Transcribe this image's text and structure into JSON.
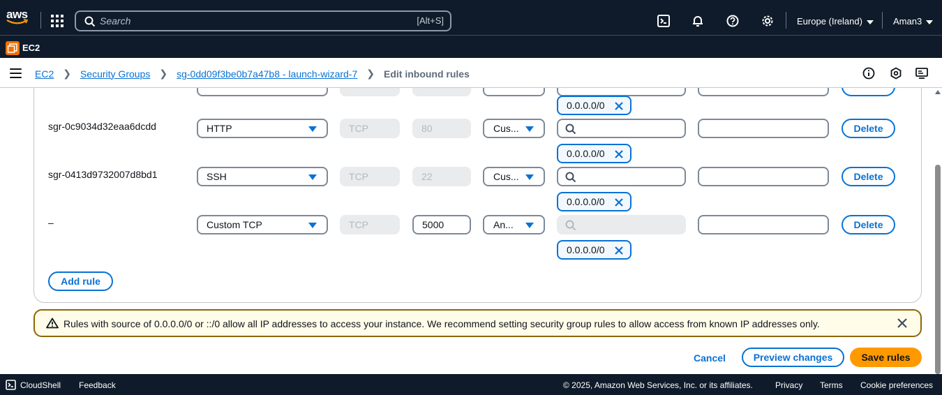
{
  "header": {
    "logo_text": "aws",
    "search_placeholder": "Search",
    "search_shortcut": "[Alt+S]",
    "region": "Europe (Ireland)",
    "user": "Aman3"
  },
  "service": {
    "name": "EC2"
  },
  "breadcrumbs": {
    "items": [
      "EC2",
      "Security Groups",
      "sg-0dd09f3be0b7a47b8 - launch-wizard-7"
    ],
    "current": "Edit inbound rules"
  },
  "rules": [
    {
      "id": "sgr-0c9034d32eaa6dcdd",
      "type": "HTTP",
      "protocol": "TCP",
      "port": "80",
      "source_type": "Cus...",
      "cidr": "0.0.0.0/0",
      "action": "Delete"
    },
    {
      "id": "sgr-0413d9732007d8bd1",
      "type": "SSH",
      "protocol": "TCP",
      "port": "22",
      "source_type": "Cus...",
      "cidr": "0.0.0.0/0",
      "action": "Delete"
    },
    {
      "id": "–",
      "type": "Custom TCP",
      "protocol": "TCP",
      "port": "5000",
      "source_type": "An...",
      "cidr": "0.0.0.0/0",
      "action": "Delete"
    }
  ],
  "previous_cidr": "0.0.0.0/0",
  "add_rule_label": "Add rule",
  "warning_text": "Rules with source of 0.0.0.0/0 or ::/0 allow all IP addresses to access your instance. We recommend setting security group rules to allow access from known IP addresses only.",
  "actions": {
    "cancel": "Cancel",
    "preview": "Preview changes",
    "save": "Save rules"
  },
  "footer": {
    "cloudshell": "CloudShell",
    "feedback": "Feedback",
    "copyright": "© 2025, Amazon Web Services, Inc. or its affiliates.",
    "privacy": "Privacy",
    "terms": "Terms",
    "cookies": "Cookie preferences"
  },
  "colors": {
    "nav_bg": "#0f1b2a",
    "link": "#0972d3",
    "primary": "#ff9900",
    "warning_border": "#8d6605",
    "warning_bg": "#fffce9"
  }
}
